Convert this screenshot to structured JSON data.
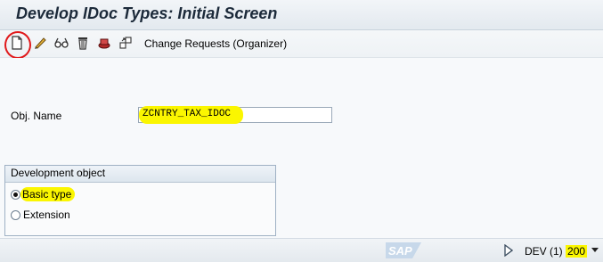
{
  "window": {
    "title": "Develop IDoc Types: Initial Screen"
  },
  "toolbar": {
    "icons": [
      "create-icon",
      "change-icon",
      "display-icon",
      "delete-icon",
      "copy-icon",
      "rename-icon"
    ],
    "change_requests_label": "Change Requests (Organizer)"
  },
  "form": {
    "obj_name_label": "Obj. Name",
    "obj_name_value": "ZCNTRY_TAX_IDOC"
  },
  "development_object": {
    "title": "Development object",
    "options": [
      {
        "label": "Basic type",
        "selected": true
      },
      {
        "label": "Extension",
        "selected": false
      }
    ]
  },
  "status": {
    "logo": "SAP",
    "system": "DEV (1)",
    "client": "200"
  },
  "colors": {
    "highlight": "#fbf600",
    "annotation_circle": "#e0191b"
  }
}
